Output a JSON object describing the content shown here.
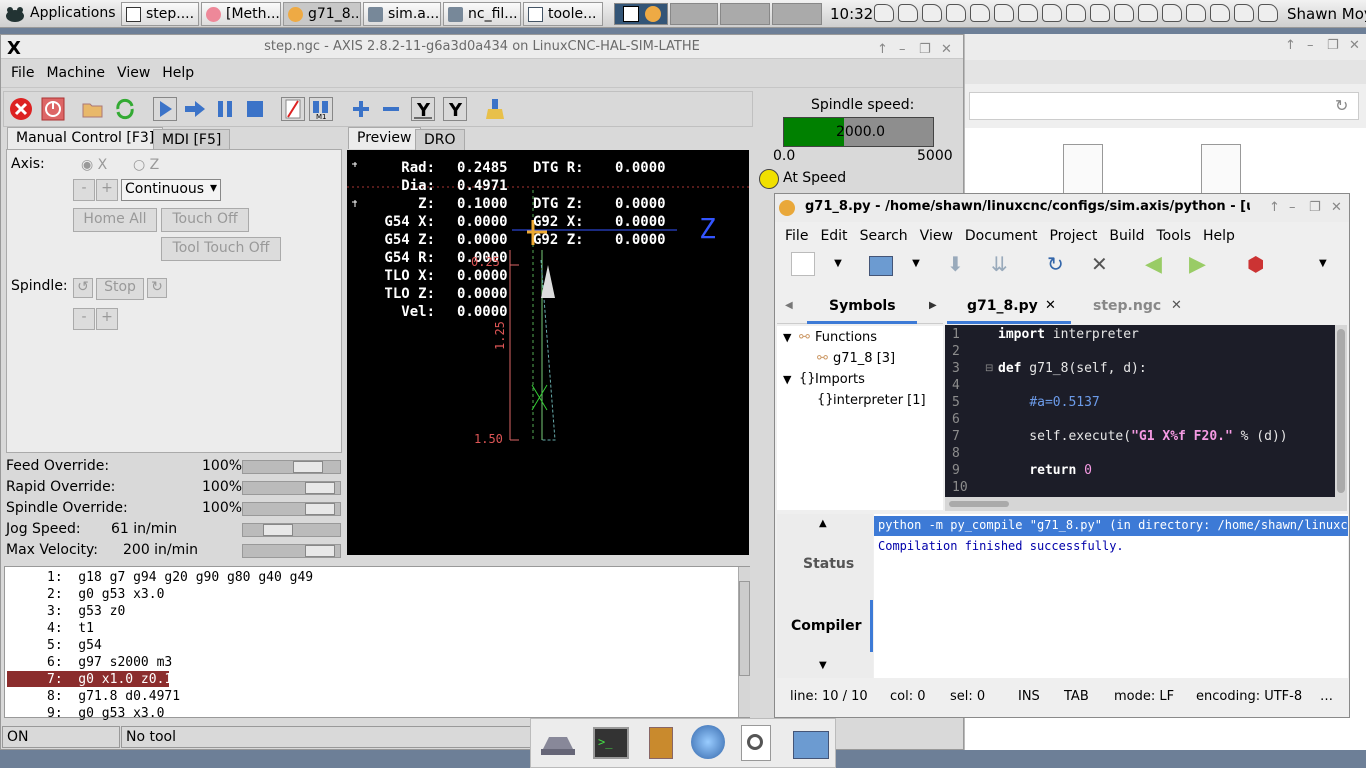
{
  "panel": {
    "apps_label": "Applications",
    "tasks": [
      "step....",
      "[Meth...",
      "g71_8...",
      "sim.a...",
      "nc_fil...",
      "toole..."
    ],
    "clock": "10:32",
    "user": "Shawn Moy"
  },
  "axis": {
    "title": "step.ngc - AXIS 2.8.2-11-g6a3d0a434 on LinuxCNC-HAL-SIM-LATHE",
    "menu": [
      "File",
      "Machine",
      "View",
      "Help"
    ],
    "spindle_speed_label": "Spindle speed:",
    "spindle_value": "2000.0",
    "spindle_fraction": 0.4,
    "spindle_min": "0.0",
    "spindle_max": "5000",
    "at_speed": "At Speed",
    "tabs": {
      "manual": "Manual Control [F3]",
      "mdi": "MDI [F5]",
      "preview": "Preview",
      "dro": "DRO"
    },
    "manual": {
      "axis_label": "Axis:",
      "axis_x": "X",
      "axis_z": "Z",
      "minus": "-",
      "plus": "+",
      "jog_mode": "Continuous",
      "home_all": "Home All",
      "touch_off": "Touch Off",
      "tool_touch_off": "Tool Touch Off",
      "spindle_label": "Spindle:",
      "stop": "Stop"
    },
    "overrides": [
      {
        "label": "Feed Override:",
        "value": "100%",
        "level": 0.75
      },
      {
        "label": "Rapid Override:",
        "value": "100%",
        "level": 0.92
      },
      {
        "label": "Spindle Override:",
        "value": "100%",
        "level": 0.92
      },
      {
        "label": "Jog Speed:",
        "value": "61 in/min",
        "level": 0.3
      },
      {
        "label": "Max Velocity:",
        "value": "200 in/min",
        "level": 0.92
      }
    ],
    "dro": [
      {
        "l": "Rad:",
        "v": "0.2485",
        "l2": "DTG R:",
        "v2": "0.0000"
      },
      {
        "l": "Dia:",
        "v": "0.4971",
        "l2": "",
        "v2": ""
      },
      {
        "l": "Z:",
        "v": "0.1000",
        "l2": "DTG Z:",
        "v2": "0.0000"
      },
      {
        "l": "G54 X:",
        "v": "0.0000",
        "l2": "G92 X:",
        "v2": "0.0000"
      },
      {
        "l": "G54 Z:",
        "v": "0.0000",
        "l2": "G92 Z:",
        "v2": "0.0000"
      },
      {
        "l": "G54 R:",
        "v": "0.0000",
        "l2": "",
        "v2": ""
      },
      {
        "l": "TLO X:",
        "v": "0.0000",
        "l2": "",
        "v2": ""
      },
      {
        "l": "TLO Z:",
        "v": "0.0000",
        "l2": "",
        "v2": ""
      },
      {
        "l": "Vel:",
        "v": "0.0000",
        "l2": "",
        "v2": ""
      }
    ],
    "preview_labels": {
      "dim_a": "0.25",
      "dim_b": "1.25",
      "dim_c": "1.50",
      "axis_z": "Z"
    },
    "gcode": [
      "1:  g18 g7 g94 g20 g90 g80 g40 g49",
      "2:  g0 g53 x3.0",
      "3:  g53 z0",
      "4:  t1",
      "5:  g54",
      "6:  g97 s2000 m3",
      "7:  g0 x1.0 z0.1",
      "8:  g71.8 d0.4971",
      "9:  g0 g53 x3.0"
    ],
    "status_on": "ON",
    "status_tool": "No tool"
  },
  "geany": {
    "title": "g71_8.py - /home/shawn/linuxcnc/configs/sim.axis/python - [untitled]",
    "menu": [
      "File",
      "Edit",
      "Search",
      "View",
      "Document",
      "Project",
      "Build",
      "Tools",
      "Help"
    ],
    "sidebar_tab": "Symbols",
    "doc_tabs": [
      "g71_8.py",
      "step.ngc"
    ],
    "tree": {
      "functions": "Functions",
      "func_item": "g71_8 [3]",
      "imports": "Imports",
      "imp_item": "interpreter [1]"
    },
    "code_lines": [
      "1",
      "2",
      "3",
      "4",
      "5",
      "6",
      "7",
      "8",
      "9",
      "10"
    ],
    "msg_tabs": {
      "status": "Status",
      "compiler": "Compiler"
    },
    "compile_cmd": "python -m py_compile \"g71_8.py\" (in directory: /home/shawn/linuxcnc",
    "compile_result": "Compilation finished successfully.",
    "status": {
      "line": "line: 10 / 10",
      "col": "col: 0",
      "sel": "sel: 0",
      "ins": "INS",
      "tab": "TAB",
      "mode": "mode: LF",
      "enc": "encoding: UTF-8",
      "more": "…"
    }
  },
  "dock": [
    "network-icon",
    "terminal-icon",
    "files-icon",
    "browser-icon",
    "search-icon",
    "folder-icon"
  ]
}
